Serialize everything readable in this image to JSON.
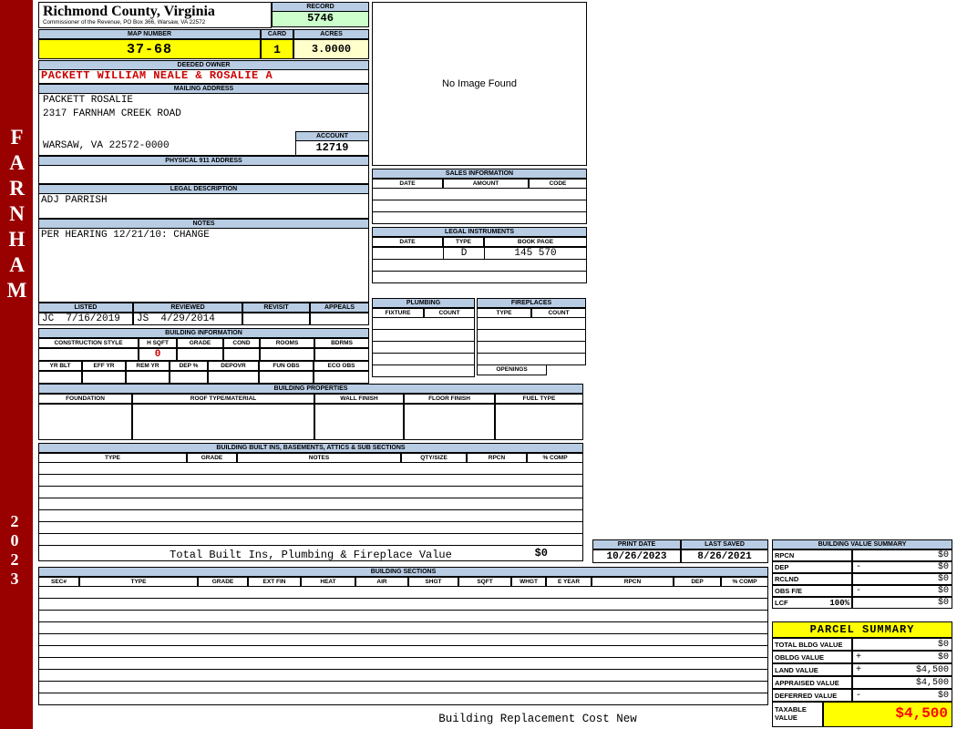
{
  "colors": {
    "header_bar": "#B8CCE4",
    "record_bg": "#CCFFCC",
    "highlight_yellow": "#FFFF00",
    "acres_bg": "#FFFFCC",
    "sidebar_bg": "#990000",
    "owner_red": "#CC0000",
    "taxable_red": "#FF0000"
  },
  "sidebar": {
    "district": "FARNHAM",
    "year": "2023"
  },
  "header": {
    "county": "Richmond County, Virginia",
    "office_line": "Commissioner of the Revenue, PO Box 366, Warsaw, VA 22572",
    "record_label": "RECORD",
    "record_value": "5746",
    "map_label": "MAP NUMBER",
    "map_value": "37-68",
    "card_label": "CARD",
    "card_value": "1",
    "acres_label": "ACRES",
    "acres_value": "3.0000"
  },
  "owner": {
    "deeded_label": "DEEDED OWNER",
    "deeded_name": "PACKETT WILLIAM NEALE & ROSALIE A",
    "mailing_label": "MAILING ADDRESS",
    "mailing_line1": "PACKETT ROSALIE",
    "mailing_line2": "2317 FARNHAM CREEK ROAD",
    "mailing_line3": "WARSAW, VA 22572-0000",
    "account_label": "ACCOUNT",
    "account_value": "12719",
    "physical_label": "PHYSICAL 911 ADDRESS",
    "legal_label": "LEGAL DESCRIPTION",
    "legal_value": "ADJ PARRISH",
    "notes_label": "NOTES",
    "notes_value": "PER HEARING 12/21/10: CHANGE"
  },
  "photo": {
    "placeholder": "No Image Found"
  },
  "sales": {
    "title": "SALES INFORMATION",
    "columns": [
      "DATE",
      "AMOUNT",
      "CODE"
    ]
  },
  "legal_instruments": {
    "title": "LEGAL INSTRUMENTS",
    "columns": [
      "DATE",
      "TYPE",
      "BOOK PAGE"
    ],
    "rows": [
      [
        "",
        "D",
        "145 570"
      ],
      [
        "",
        "",
        ""
      ],
      [
        "",
        "",
        ""
      ]
    ]
  },
  "plumbing": {
    "title": "PLUMBING",
    "columns": [
      "FIXTURE",
      "COUNT"
    ]
  },
  "fireplaces": {
    "title": "FIREPLACES",
    "columns": [
      "TYPE",
      "COUNT"
    ],
    "openings_label": "OPENINGS"
  },
  "review": {
    "columns": [
      "LISTED",
      "REVIEWED",
      "REVISIT",
      "APPEALS"
    ],
    "values": [
      "JC  7/16/2019",
      "JS  4/29/2014",
      "",
      ""
    ]
  },
  "building_info": {
    "title": "BUILDING INFORMATION",
    "columns_row1": [
      "CONSTRUCTION STYLE",
      "H SQFT",
      "GRADE",
      "COND",
      "ROOMS",
      "BDRMS"
    ],
    "values_row1": [
      "",
      "0",
      "",
      "",
      "",
      ""
    ],
    "columns_row2": [
      "YR BLT",
      "EFF YR",
      "REM YR",
      "DEP %",
      "DEPOVR",
      "FUN OBS",
      "ECO OBS"
    ],
    "values_row2": [
      "",
      "",
      "",
      "",
      "",
      "",
      ""
    ]
  },
  "building_properties": {
    "title": "BUILDING PROPERTIES",
    "columns": [
      "FOUNDATION",
      "ROOF TYPE/MATERIAL",
      "WALL FINISH",
      "FLOOR FINISH",
      "FUEL TYPE"
    ]
  },
  "built_ins": {
    "title": "BUILDING BUILT INS, BASEMENTS, ATTICS & SUB SECTIONS",
    "columns": [
      "TYPE",
      "GRADE",
      "NOTES",
      "QTY/SIZE",
      "RPCN",
      "% COMP"
    ],
    "total_label": "Total Built Ins, Plumbing & Fireplace Value",
    "total_value": "$0"
  },
  "dates": {
    "print_label": "PRINT DATE",
    "print_value": "10/26/2023",
    "saved_label": "LAST SAVED",
    "saved_value": "8/26/2021"
  },
  "building_value_summary": {
    "title": "BUILDING VALUE SUMMARY",
    "rows": [
      {
        "label": "RPCN",
        "extra": "",
        "op": "",
        "value": "$0"
      },
      {
        "label": "DEP",
        "extra": "",
        "op": "-",
        "value": "$0"
      },
      {
        "label": "RCLND",
        "extra": "",
        "op": "",
        "value": "$0"
      },
      {
        "label": "OBS F/E",
        "extra": "",
        "op": "-",
        "value": "$0"
      },
      {
        "label": "LCF",
        "extra": "100%",
        "op": "",
        "value": "$0"
      }
    ]
  },
  "building_sections": {
    "title": "BUILDING SECTIONS",
    "columns": [
      "SEC#",
      "TYPE",
      "GRADE",
      "EXT FIN",
      "HEAT",
      "AIR",
      "SHGT",
      "SQFT",
      "WHGT",
      "E YEAR",
      "RPCN",
      "DEP",
      "% COMP"
    ]
  },
  "parcel_summary": {
    "title": "PARCEL SUMMARY",
    "rows": [
      {
        "label": "TOTAL BLDG VALUE",
        "op": "",
        "value": "$0"
      },
      {
        "label": "OBLDG VALUE",
        "op": "+",
        "value": "$0"
      },
      {
        "label": "LAND VALUE",
        "op": "+",
        "value": "$4,500"
      },
      {
        "label": "APPRAISED VALUE",
        "op": "",
        "value": "$4,500"
      },
      {
        "label": "DEFERRED VALUE",
        "op": "-",
        "value": "$0"
      }
    ],
    "taxable_label": "TAXABLE VALUE",
    "taxable_value": "$4,500"
  },
  "footer": {
    "caption": "Building Replacement Cost New"
  }
}
